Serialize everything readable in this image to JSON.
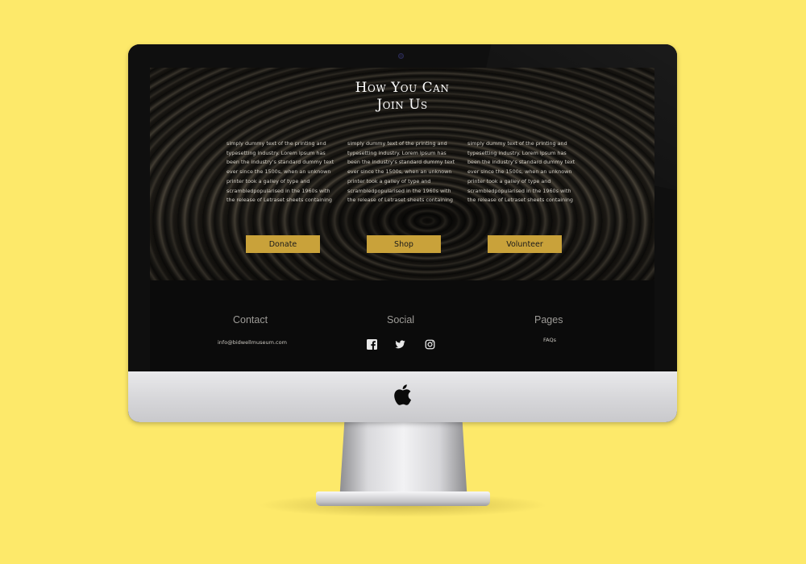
{
  "hero": {
    "title_line1": "How You Can",
    "title_line2": "Join Us",
    "columns": [
      {
        "text": "simply dummy text of the printing and typesetting industry. Lorem Ipsum has been the industry's standard dummy text ever since the 1500s, when an unknown printer took a galley of type and scrambledpopularised in the 1960s with the release of Letraset sheets containing"
      },
      {
        "text": "simply dummy text of the printing and typesetting industry. Lorem Ipsum has been the industry's standard dummy text ever since the 1500s, when an unknown printer took a galley of type and scrambledpopularised in the 1960s with the release of Letraset sheets containing"
      },
      {
        "text": "simply dummy text of the printing and typesetting industry. Lorem Ipsum has been the industry's standard dummy text ever since the 1500s, when an unknown printer took a galley of type and scrambledpopularised in the 1960s with the release of Letraset sheets containing"
      }
    ],
    "buttons": {
      "donate": "Donate",
      "shop": "Shop",
      "volunteer": "Volunteer"
    }
  },
  "footer": {
    "contact": {
      "heading": "Contact",
      "email": "info@bidwellmuseum.com"
    },
    "social": {
      "heading": "Social",
      "icons": [
        "facebook-icon",
        "twitter-icon",
        "instagram-icon"
      ]
    },
    "pages": {
      "heading": "Pages",
      "first_link": "FAQs"
    }
  },
  "colors": {
    "background": "#fde96a",
    "button": "#c9a23a",
    "footer": "#0b0b0b"
  }
}
